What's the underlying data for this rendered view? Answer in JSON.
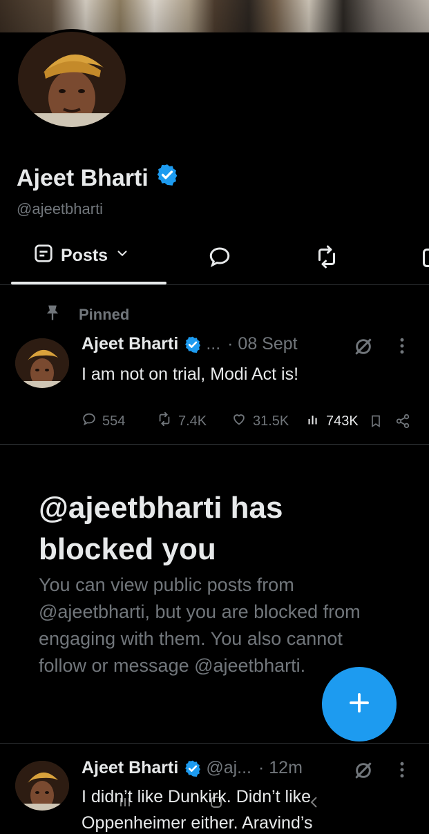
{
  "profile": {
    "name": "Ajeet Bharti",
    "handle": "@ajeetbharti"
  },
  "tabs": {
    "active_label": "Posts",
    "icons": [
      "posts-icon",
      "chevron-down-icon",
      "replies-icon",
      "reposts-icon",
      "media-icon"
    ]
  },
  "pinned_tweet": {
    "pinned_label": "Pinned",
    "author": "Ajeet Bharti",
    "handle_truncated": "...",
    "time": "· 08 Sept",
    "text": "I am not on trial, Modi Act is!",
    "replies": "554",
    "reposts": "7.4K",
    "likes": "31.5K",
    "views": "743K"
  },
  "blocked_notice": {
    "title": "@ajeetbharti has blocked you",
    "description": "You can view public posts from @ajeetbharti, but you are blocked from engaging with them. You also cannot follow or message @ajeetbharti."
  },
  "second_tweet": {
    "author": "Ajeet Bharti",
    "handle_truncated": "@aj...",
    "time": "· 12m",
    "text_line1": "I didn’t like Dunkirk. Didn’t like",
    "text_line2": "Oppenheimer either. Aravind’s"
  },
  "colors": {
    "background": "#000000",
    "text_primary": "#e7e9ea",
    "text_secondary": "#71767b",
    "accent": "#1d9bf0",
    "divider": "#2f3336"
  }
}
